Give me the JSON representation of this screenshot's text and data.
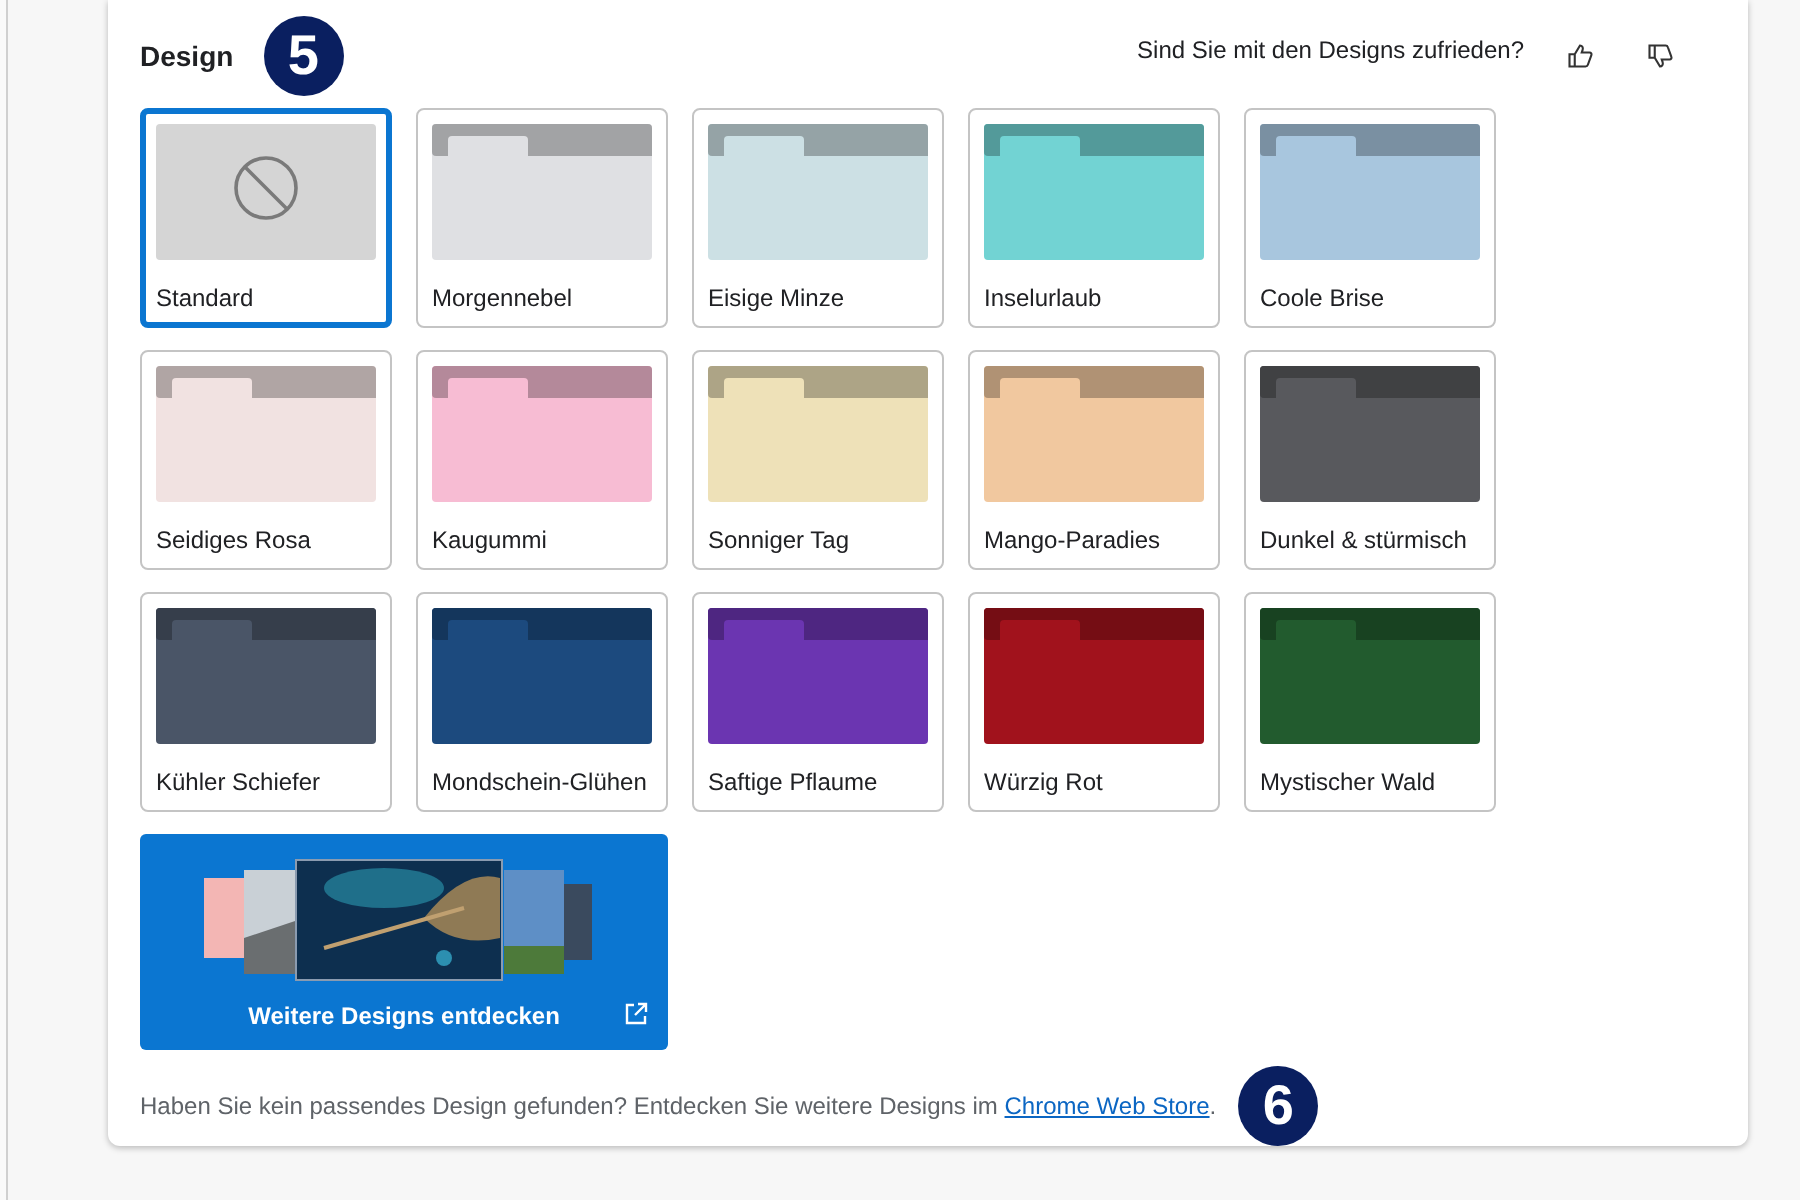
{
  "header": {
    "title": "Design",
    "marker": "5",
    "feedback_question": "Sind Sie mit den Designs zufrieden?"
  },
  "themes": [
    {
      "label": "Standard",
      "kind": "none",
      "selected": true
    },
    {
      "label": "Morgennebel",
      "kind": "folder",
      "selected": false,
      "color": "#dfe0e3"
    },
    {
      "label": "Eisige Minze",
      "kind": "folder",
      "selected": false,
      "color": "#cce0e4"
    },
    {
      "label": "Inselurlaub",
      "kind": "folder",
      "selected": false,
      "color": "#72d3d3"
    },
    {
      "label": "Coole Brise",
      "kind": "folder",
      "selected": false,
      "color": "#a8c6de"
    },
    {
      "label": "Seidiges Rosa",
      "kind": "folder",
      "selected": false,
      "color": "#f1e2e1"
    },
    {
      "label": "Kaugummi",
      "kind": "folder",
      "selected": false,
      "color": "#f7bcd3"
    },
    {
      "label": "Sonniger Tag",
      "kind": "folder",
      "selected": false,
      "color": "#eee1b8"
    },
    {
      "label": "Mango-Paradies",
      "kind": "folder",
      "selected": false,
      "color": "#f1c89f"
    },
    {
      "label": "Dunkel & stürmisch",
      "kind": "folder",
      "selected": false,
      "color": "#58595d"
    },
    {
      "label": "Kühler Schiefer",
      "kind": "folder",
      "selected": false,
      "color": "#4a5567"
    },
    {
      "label": "Mondschein-Glühen",
      "kind": "folder",
      "selected": false,
      "color": "#1c4a7e"
    },
    {
      "label": "Saftige Pflaume",
      "kind": "folder",
      "selected": false,
      "color": "#6b35b1"
    },
    {
      "label": "Würzig Rot",
      "kind": "folder",
      "selected": false,
      "color": "#a1121c"
    },
    {
      "label": "Mystischer Wald",
      "kind": "folder",
      "selected": false,
      "color": "#225b2e"
    }
  ],
  "more_designs": {
    "label": "Weitere Designs entdecken"
  },
  "footer": {
    "text": "Haben Sie kein passendes Design gefunden? Entdecken Sie weitere Designs im ",
    "link": "Chrome Web Store",
    "text_after": ".",
    "marker": "6"
  }
}
